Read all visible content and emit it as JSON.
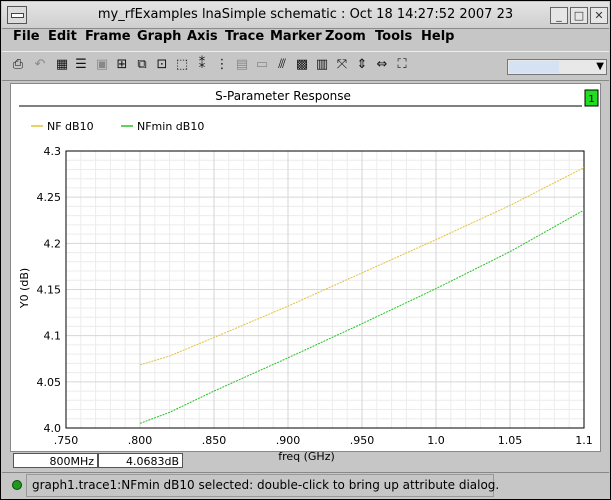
{
  "window": {
    "title": "my_rfExamples lnaSimple schematic : Oct 18 14:27:52 2007 23"
  },
  "menu": [
    "File",
    "Edit",
    "Frame",
    "Graph",
    "Axis",
    "Trace",
    "Marker",
    "Zoom",
    "Tools",
    "Help"
  ],
  "toolbar": {
    "icons": [
      "printer-icon",
      "undo-icon",
      "grid-icon",
      "list-icon",
      "frame-icon",
      "split-icon",
      "subwindow-icon",
      "zoom-in-icon",
      "copy-icon",
      "legend-icon",
      "strip-icon",
      "table-icon",
      "tag-icon",
      "axis-icon",
      "calculator-icon",
      "fit-icon",
      "fit-y-icon",
      "fit-x-icon",
      "zoom-fit-icon"
    ]
  },
  "graph": {
    "subwindow_badge": "1"
  },
  "chart_data": {
    "type": "line",
    "title": "S-Parameter Response",
    "xlabel": "freq (GHz)",
    "ylabel": "Y0 (dB)",
    "xlim": [
      0.75,
      1.1
    ],
    "ylim": [
      4.0,
      4.3
    ],
    "x_ticks": [
      ".750",
      ".800",
      ".850",
      ".900",
      ".950",
      "1.0",
      "1.05",
      "1.1"
    ],
    "y_ticks": [
      "4.0",
      "4.05",
      "4.1",
      "4.15",
      "4.2",
      "4.25",
      "4.3"
    ],
    "grid": true,
    "legend_position": "top-left",
    "series": [
      {
        "name": "NF dB10",
        "color": "#e0c23a",
        "x": [
          0.8,
          0.82,
          0.85,
          0.9,
          0.95,
          1.0,
          1.05,
          1.1
        ],
        "y": [
          4.0683,
          4.078,
          4.098,
          4.132,
          4.168,
          4.204,
          4.241,
          4.282
        ]
      },
      {
        "name": "NFmin dB10",
        "color": "#27c227",
        "x": [
          0.8,
          0.82,
          0.85,
          0.9,
          0.95,
          1.0,
          1.05,
          1.1
        ],
        "y": [
          4.005,
          4.017,
          4.04,
          4.076,
          4.113,
          4.151,
          4.191,
          4.236
        ]
      }
    ]
  },
  "readouts": {
    "x_value": "800MHz",
    "y_value": "4.0683dB"
  },
  "status": {
    "message": "graph1.trace1:NFmin dB10 selected: double-click to bring up attribute dialog."
  }
}
